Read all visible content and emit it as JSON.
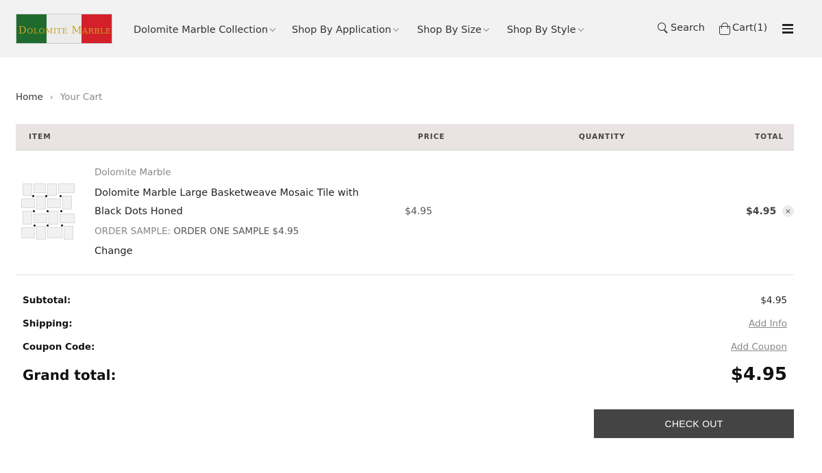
{
  "header": {
    "logo_text": "Dolomite Marble",
    "nav": [
      {
        "label": "Dolomite Marble Collection"
      },
      {
        "label": "Shop By Application"
      },
      {
        "label": "Shop By Size"
      },
      {
        "label": "Shop By Style"
      }
    ],
    "search_label": "Search",
    "cart_label": "Cart(1)"
  },
  "breadcrumb": {
    "home": "Home",
    "separator": "›",
    "current": "Your Cart"
  },
  "table": {
    "headers": {
      "item": "ITEM",
      "price": "PRICE",
      "quantity": "QUANTITY",
      "total": "TOTAL"
    }
  },
  "cart_item": {
    "brand": "Dolomite Marble",
    "title": "Dolomite Marble Large Basketweave Mosaic Tile with Black Dots Honed",
    "option_label": "ORDER SAMPLE:",
    "option_value": "ORDER ONE SAMPLE $4.95",
    "change_label": "Change",
    "price": "$4.95",
    "total": "$4.95",
    "remove_glyph": "×"
  },
  "summary": {
    "subtotal_label": "Subtotal:",
    "subtotal_value": "$4.95",
    "shipping_label": "Shipping:",
    "shipping_link": "Add Info",
    "coupon_label": "Coupon Code:",
    "coupon_link": "Add Coupon",
    "grand_total_label": "Grand total:",
    "grand_total_value": "$4.95"
  },
  "checkout_label": "CHECK OUT",
  "colors": {
    "header_bg": "#f2f2f2",
    "table_header_bg": "#e9e3e3",
    "checkout_bg": "#444444",
    "logo_green": "#1f6b2e",
    "logo_red": "#d4202a",
    "logo_gold": "#c9a227"
  },
  "icons": [
    "search-icon",
    "cart-icon",
    "menu-icon",
    "chevron-down-icon",
    "close-icon"
  ]
}
